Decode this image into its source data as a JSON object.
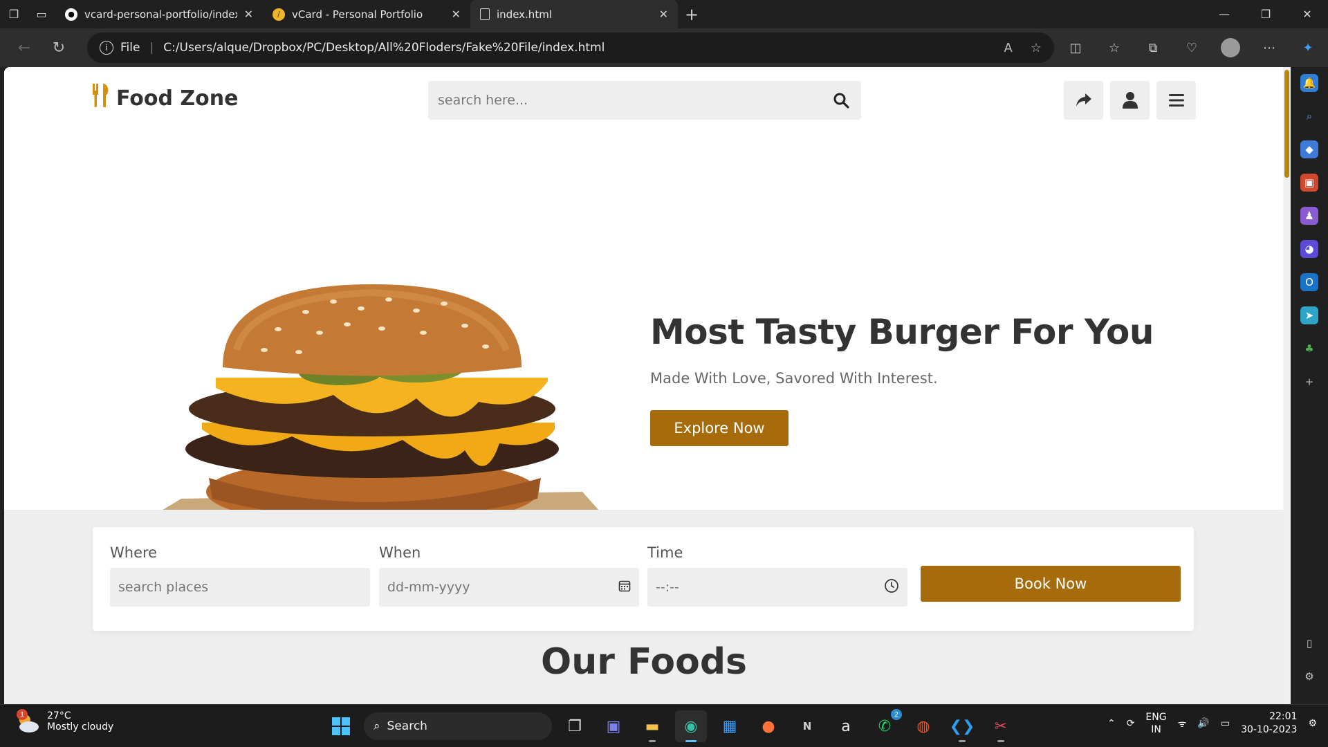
{
  "browser": {
    "tabs": [
      {
        "title": "vcard-personal-portfolio/index.h",
        "active": false
      },
      {
        "title": "vCard - Personal Portfolio",
        "active": false
      },
      {
        "title": "index.html",
        "active": true
      }
    ],
    "address": {
      "scheme_label": "File",
      "url": "C:/Users/alque/Dropbox/PC/Desktop/All%20Floders/Fake%20File/index.html"
    }
  },
  "site": {
    "logo_text": "Food Zone",
    "search_placeholder": "search here...",
    "hero": {
      "title": "Most Tasty Burger For You",
      "subtitle": "Made With Love, Savored With Interest.",
      "cta_label": "Explore Now"
    },
    "booking": {
      "where_label": "Where",
      "where_placeholder": "search places",
      "when_label": "When",
      "when_placeholder": "dd-mm-yyyy",
      "time_label": "Time",
      "time_placeholder": "--:--",
      "button_label": "Book Now"
    },
    "section_heading": "Our Foods",
    "accent_color": "#a66b0b"
  },
  "taskbar": {
    "weather": {
      "temp": "27°C",
      "condition": "Mostly cloudy",
      "badge": "1"
    },
    "search_label": "Search",
    "whatsapp_badge": "2",
    "language": {
      "line1": "ENG",
      "line2": "IN"
    },
    "clock": {
      "time": "22:01",
      "date": "30-10-2023"
    }
  }
}
